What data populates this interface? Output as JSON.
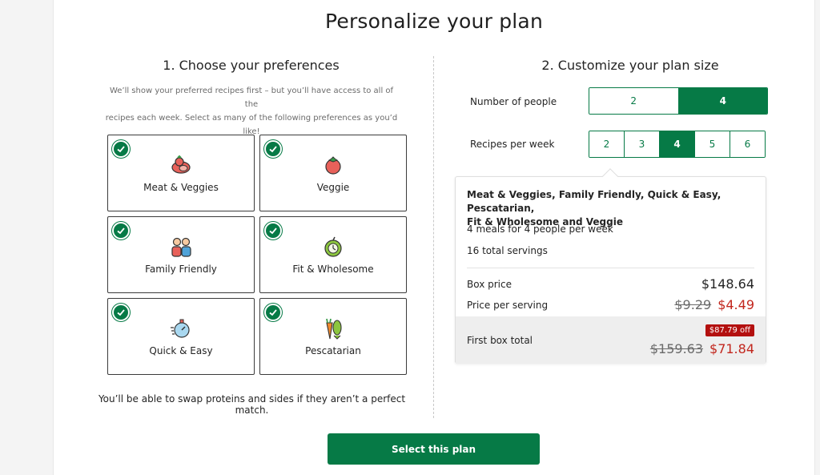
{
  "title": "Personalize your plan",
  "preferences": {
    "heading": "1. Choose your preferences",
    "subtitle_line1": "We’ll show your preferred recipes first – but you’ll have access to all of the",
    "subtitle_line2": "recipes each week. Select as many of the following preferences as you’d like!",
    "tiles": [
      {
        "label": "Meat & Veggies",
        "icon": "meat-veggies-icon",
        "checked": true
      },
      {
        "label": "Veggie",
        "icon": "tomato-icon",
        "checked": true
      },
      {
        "label": "Family Friendly",
        "icon": "family-icon",
        "checked": true
      },
      {
        "label": "Fit & Wholesome",
        "icon": "apple-icon",
        "checked": true
      },
      {
        "label": "Quick & Easy",
        "icon": "stopwatch-icon",
        "checked": true
      },
      {
        "label": "Pescatarian",
        "icon": "fish-carrot-icon",
        "checked": true
      }
    ],
    "note": "You’ll be able to swap proteins and sides if they aren’t a perfect match."
  },
  "plan_size": {
    "heading": "2. Customize your plan size",
    "people_label": "Number of people",
    "people_options": [
      "2",
      "4"
    ],
    "people_selected": "4",
    "recipes_label": "Recipes per week",
    "recipes_options": [
      "2",
      "3",
      "4",
      "5",
      "6"
    ],
    "recipes_selected": "4"
  },
  "summary": {
    "prefs_line1": "Meat & Veggies, Family Friendly, Quick & Easy, Pescatarian,",
    "prefs_line2": "Fit & Wholesome and Veggie",
    "meals": "4 meals for 4 people per week",
    "servings": "16 total servings",
    "box_price_label": "Box price",
    "box_price": "$148.64",
    "per_serving_label": "Price per serving",
    "per_serving_old": "$9.29",
    "per_serving_new": "$4.49",
    "first_box_label": "First box total",
    "discount_badge": "$87.79 off",
    "first_box_old": "$159.63",
    "first_box_new": "$71.84"
  },
  "cta": "Select this plan",
  "colors": {
    "brand_green": "#067a46",
    "discount_red": "#c2271e",
    "badge_red": "#b3100f"
  }
}
